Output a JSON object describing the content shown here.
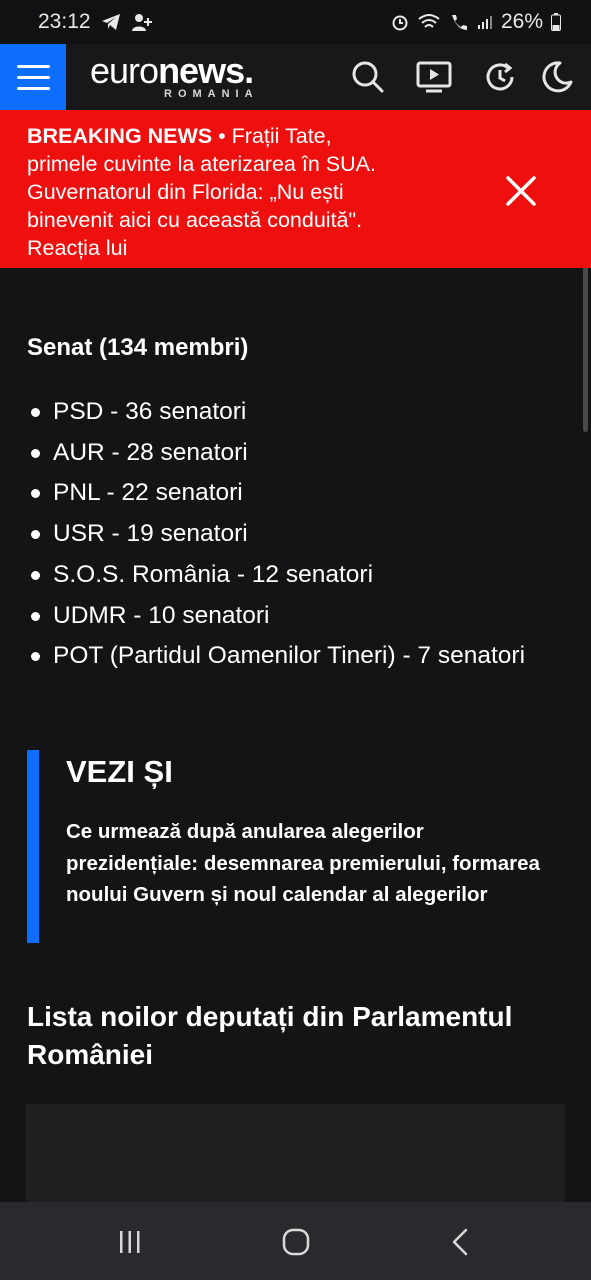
{
  "status_bar": {
    "time": "23:12",
    "battery": "26%",
    "left_icons": [
      "telegram-icon",
      "person-add-icon"
    ],
    "right_icons": [
      "alarm-icon",
      "wifi-icon",
      "wifi-call-icon",
      "signal-icon",
      "battery-icon"
    ]
  },
  "header": {
    "logo_light": "euro",
    "logo_bold": "news",
    "logo_dot": ".",
    "logo_sub": "ROMANIA",
    "icons": [
      "search-icon",
      "live-tv-icon",
      "history-icon",
      "dark-mode-icon"
    ],
    "brand_color": "#0d6efd"
  },
  "breaking": {
    "tag": "BREAKING NEWS",
    "separator": " • ",
    "text": "Frații Tate, primele cuvinte la aterizarea în SUA. Guvernatorul din Florida: „Nu ești binevenit aici cu această conduită\". Reacția lui",
    "background": "#ee0f0f"
  },
  "article": {
    "senat_title": "Senat (134 membri)",
    "senat_items": [
      "PSD - 36 senatori",
      "AUR - 28 senatori",
      "PNL - 22 senatori",
      "USR - 19 senatori",
      "S.O.S. România - 12 senatori",
      "UDMR - 10 senatori",
      "POT (Partidul Oamenilor Tineri) - 7 senatori"
    ],
    "vezi_title": "VEZI ȘI",
    "vezi_link": "Ce urmează după anularea alegerilor prezidențiale: desemnarea premierului, formarea noului Guvern și noul calendar al alegerilor",
    "section_title": "Lista noilor deputați din Parlamentul României"
  },
  "nav_bar": {
    "buttons": [
      "recent-apps-icon",
      "home-icon",
      "back-icon"
    ]
  }
}
